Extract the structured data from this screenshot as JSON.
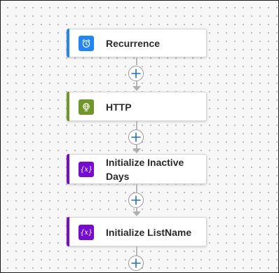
{
  "flow": {
    "steps": [
      {
        "label": "Recurrence",
        "icon": "alarm-clock-icon",
        "color": "#1f85ff"
      },
      {
        "label": "HTTP",
        "icon": "globe-icon",
        "color": "#709727"
      },
      {
        "label": "Initialize Inactive Days",
        "icon": "variable-icon",
        "icon_text": "{x}",
        "color": "#770bd6"
      },
      {
        "label": "Initialize ListName",
        "icon": "variable-icon",
        "icon_text": "{x}",
        "color": "#770bd6"
      }
    ],
    "add_action_tooltip": "+"
  }
}
